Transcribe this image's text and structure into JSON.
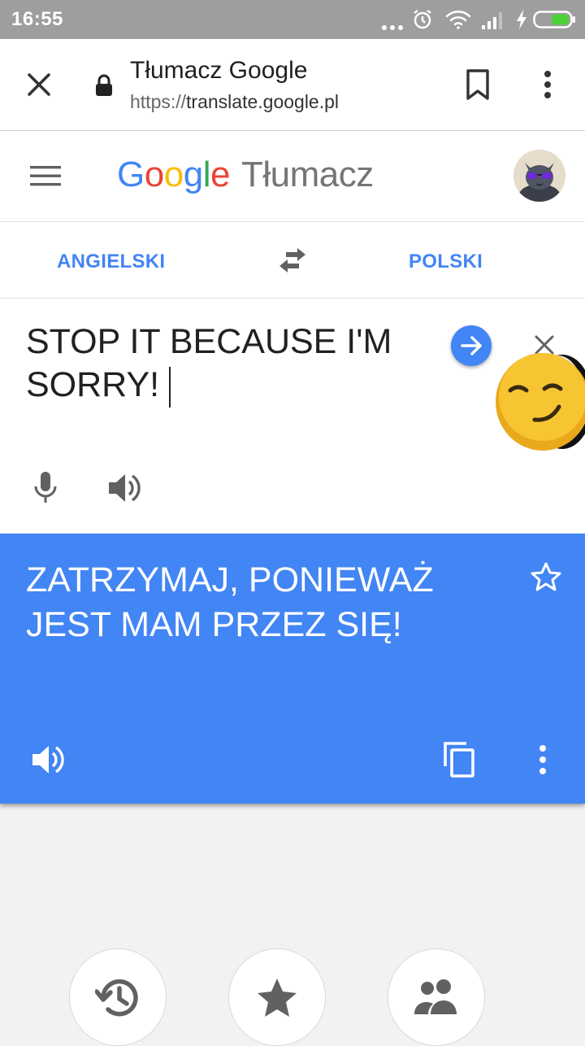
{
  "status_bar": {
    "time": "16:55"
  },
  "browser": {
    "page_title": "Tłumacz Google",
    "url_scheme": "https://",
    "url_domain": "translate.google.pl"
  },
  "app_header": {
    "logo": [
      "G",
      "o",
      "o",
      "g",
      "l",
      "e"
    ],
    "product_name": "Tłumacz"
  },
  "languages": {
    "source": "ANGIELSKI",
    "target": "POLSKI"
  },
  "source": {
    "text": "STOP IT BECAUSE I'M SORRY!"
  },
  "result": {
    "text": "ZATRZYMAJ, PONIEWAŻ JEST MAM PRZEZ SIĘ!"
  },
  "colors": {
    "accent": "#4285f4",
    "status_bar": "#9e9e9e",
    "battery": "#4cd137",
    "background": "#f2f2f2"
  },
  "icons": {
    "status_bar": [
      "more-dots-icon",
      "alarm-icon",
      "wifi-icon",
      "signal-icon",
      "charging-icon",
      "battery-icon"
    ],
    "browser": [
      "close-icon",
      "lock-icon",
      "bookmark-icon",
      "more-vert-icon"
    ],
    "bottom_buttons": [
      "history-icon",
      "star-filled-icon",
      "people-icon"
    ]
  }
}
